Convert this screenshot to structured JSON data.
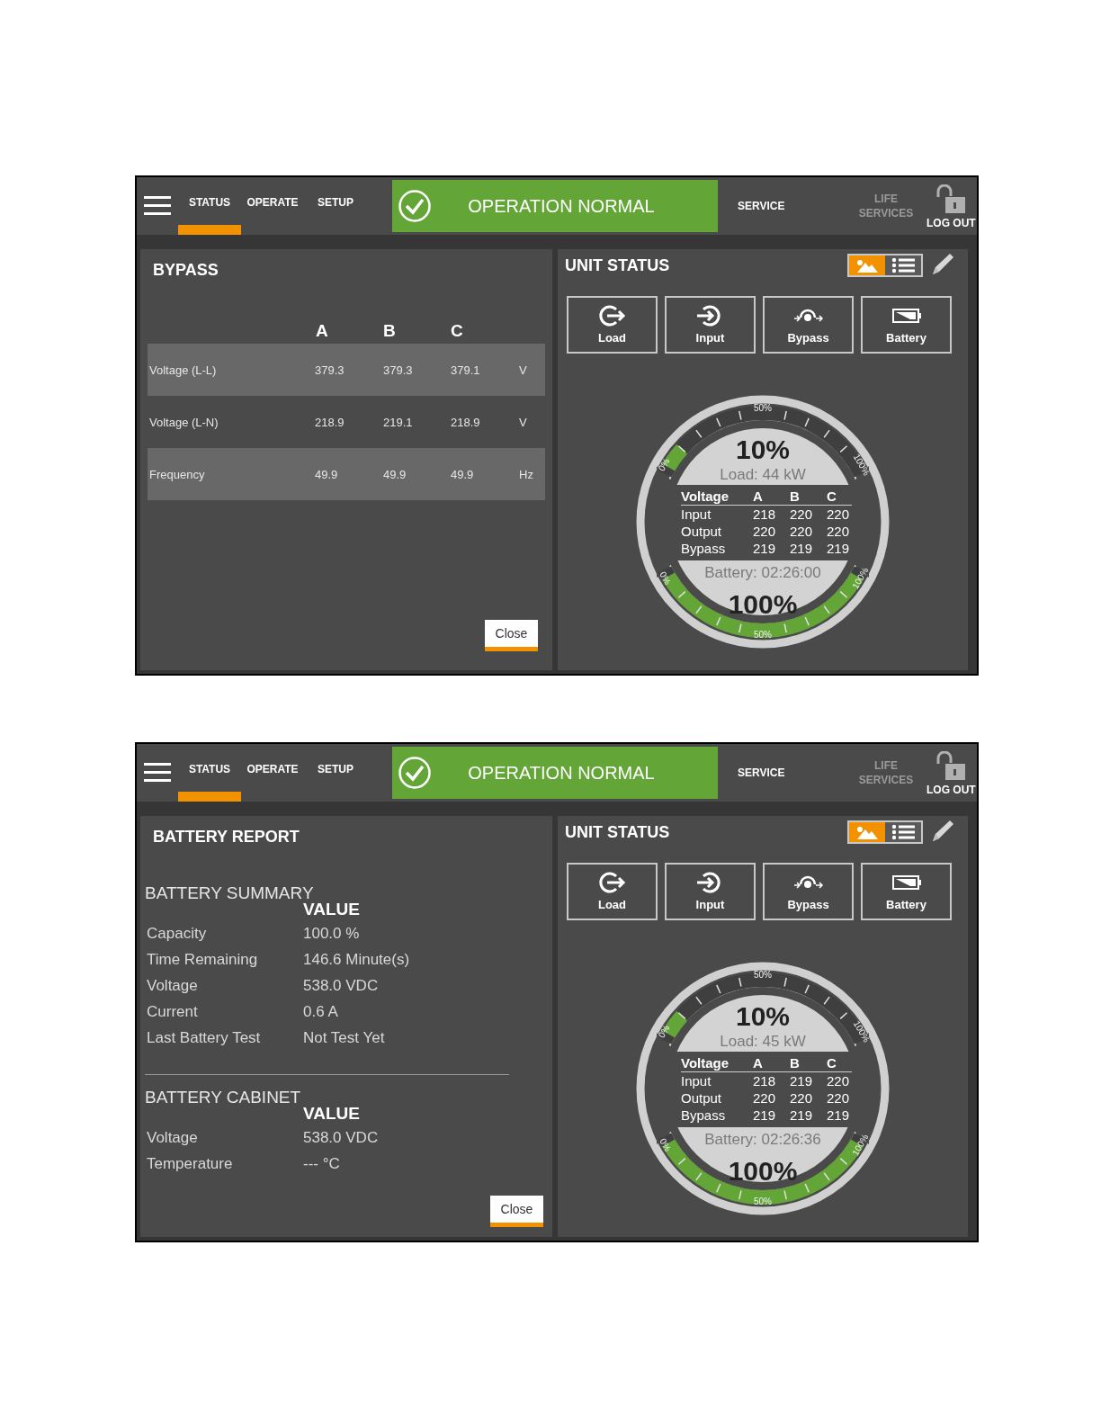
{
  "screens": [
    {
      "header": {
        "tabs": [
          {
            "label": "STATUS",
            "selected": true
          },
          {
            "label": "OPERATE",
            "selected": false
          },
          {
            "label": "SETUP",
            "selected": false
          }
        ],
        "status": "OPERATION NORMAL",
        "service": "SERVICE",
        "life_services": {
          "label": "LIFE SERVICES",
          "disabled": true
        },
        "logout": "LOG OUT"
      },
      "left_panel": {
        "kind": "bypass",
        "title": "BYPASS",
        "columns": [
          "A",
          "B",
          "C"
        ],
        "rows": [
          {
            "label": "Voltage (L-L)",
            "values": [
              "379.3",
              "379.3",
              "379.1"
            ],
            "unit": "V"
          },
          {
            "label": "Voltage (L-N)",
            "values": [
              "218.9",
              "219.1",
              "218.9"
            ],
            "unit": "V"
          },
          {
            "label": "Frequency",
            "values": [
              "49.9",
              "49.9",
              "49.9"
            ],
            "unit": "Hz"
          }
        ],
        "close": "Close"
      },
      "unit_status": {
        "title": "UNIT STATUS",
        "views": [
          {
            "kind": "picture",
            "selected": true
          },
          {
            "kind": "list",
            "selected": false
          }
        ],
        "buttons": [
          {
            "kind": "load",
            "label": "Load"
          },
          {
            "kind": "input",
            "label": "Input"
          },
          {
            "kind": "bypass",
            "label": "Bypass"
          },
          {
            "kind": "battery",
            "label": "Battery"
          }
        ],
        "gauge": {
          "load": {
            "reading": "10%",
            "label": "Load: 44 kW",
            "level": 0.1,
            "ticks": [
              "0%",
              "50%",
              "100%"
            ]
          },
          "table": {
            "columns": [
              "Voltage",
              "A",
              "B",
              "C"
            ],
            "rows": [
              [
                "Input",
                "218",
                "220",
                "220"
              ],
              [
                "Output",
                "220",
                "220",
                "220"
              ],
              [
                "Bypass",
                "219",
                "219",
                "219"
              ]
            ]
          },
          "battery": {
            "label": "Battery: 02:26:00",
            "reading": "100%",
            "level": 1,
            "ticks": [
              "0%",
              "50%",
              "100%"
            ]
          }
        }
      }
    },
    {
      "header": {
        "tabs": [
          {
            "label": "STATUS",
            "selected": true
          },
          {
            "label": "OPERATE",
            "selected": false
          },
          {
            "label": "SETUP",
            "selected": false
          }
        ],
        "status": "OPERATION NORMAL",
        "service": "SERVICE",
        "life_services": {
          "label": "LIFE SERVICES",
          "disabled": true
        },
        "logout": "LOG OUT"
      },
      "left_panel": {
        "kind": "battery_report",
        "title": "BATTERY REPORT",
        "sections": [
          {
            "title": "BATTERY SUMMARY",
            "value_header": "VALUE",
            "rows": [
              {
                "label": "Capacity",
                "value": "100.0 %"
              },
              {
                "label": "Time Remaining",
                "value": "146.6 Minute(s)"
              },
              {
                "label": "Voltage",
                "value": "538.0 VDC"
              },
              {
                "label": "Current",
                "value": "0.6 A"
              },
              {
                "label": "Last Battery Test",
                "value": "Not Test Yet"
              }
            ]
          },
          {
            "title": "BATTERY CABINET",
            "value_header": "VALUE",
            "rows": [
              {
                "label": "Voltage",
                "value": "538.0 VDC"
              },
              {
                "label": "Temperature",
                "value": "--- °C"
              }
            ]
          }
        ],
        "close": "Close"
      },
      "unit_status": {
        "title": "UNIT STATUS",
        "views": [
          {
            "kind": "picture",
            "selected": true
          },
          {
            "kind": "list",
            "selected": false
          }
        ],
        "buttons": [
          {
            "kind": "load",
            "label": "Load"
          },
          {
            "kind": "input",
            "label": "Input"
          },
          {
            "kind": "bypass",
            "label": "Bypass"
          },
          {
            "kind": "battery",
            "label": "Battery"
          }
        ],
        "gauge": {
          "load": {
            "reading": "10%",
            "label": "Load: 45 kW",
            "level": 0.1,
            "ticks": [
              "0%",
              "50%",
              "100%"
            ]
          },
          "table": {
            "columns": [
              "Voltage",
              "A",
              "B",
              "C"
            ],
            "rows": [
              [
                "Input",
                "218",
                "219",
                "220"
              ],
              [
                "Output",
                "220",
                "220",
                "220"
              ],
              [
                "Bypass",
                "219",
                "219",
                "219"
              ]
            ]
          },
          "battery": {
            "label": "Battery: 02:26:36",
            "reading": "100%",
            "level": 1,
            "ticks": [
              "0%",
              "50%",
              "100%"
            ]
          }
        }
      }
    }
  ]
}
